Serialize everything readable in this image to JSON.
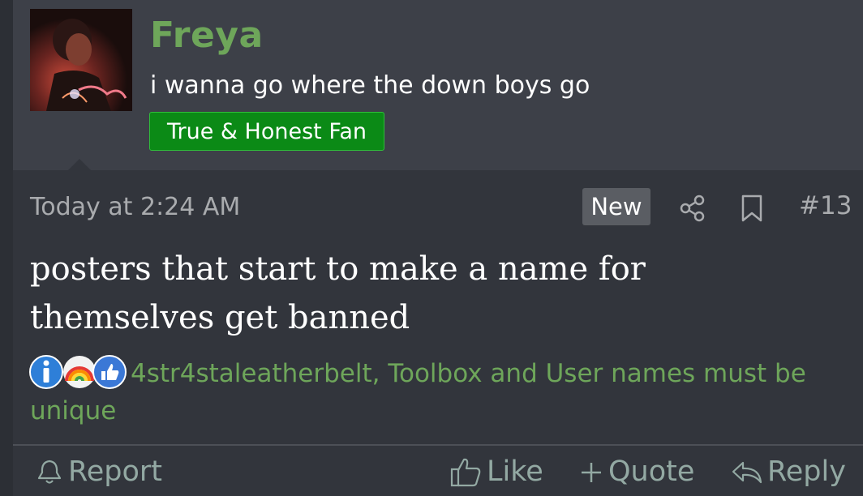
{
  "post": {
    "author": {
      "name": "Freya",
      "user_title": "i wanna go where the down boys go",
      "banner": "True & Honest Fan"
    },
    "date": "Today at 2:24 AM",
    "badge": "New",
    "number": "#13",
    "message": "posters that start to make a name for themselves get banned",
    "reactions": {
      "icons": [
        "informative-icon",
        "rainbow-icon",
        "like-icon"
      ],
      "users": "4str4staleatherbelt, Toolbox and User names must be unique"
    },
    "actions": {
      "report": "Report",
      "like": "Like",
      "quote": "Quote",
      "reply": "Reply"
    }
  },
  "colors": {
    "username": "#6ea65a",
    "banner_bg": "#0b8a16",
    "background": "#32353c",
    "header_bg": "#3d4048"
  }
}
